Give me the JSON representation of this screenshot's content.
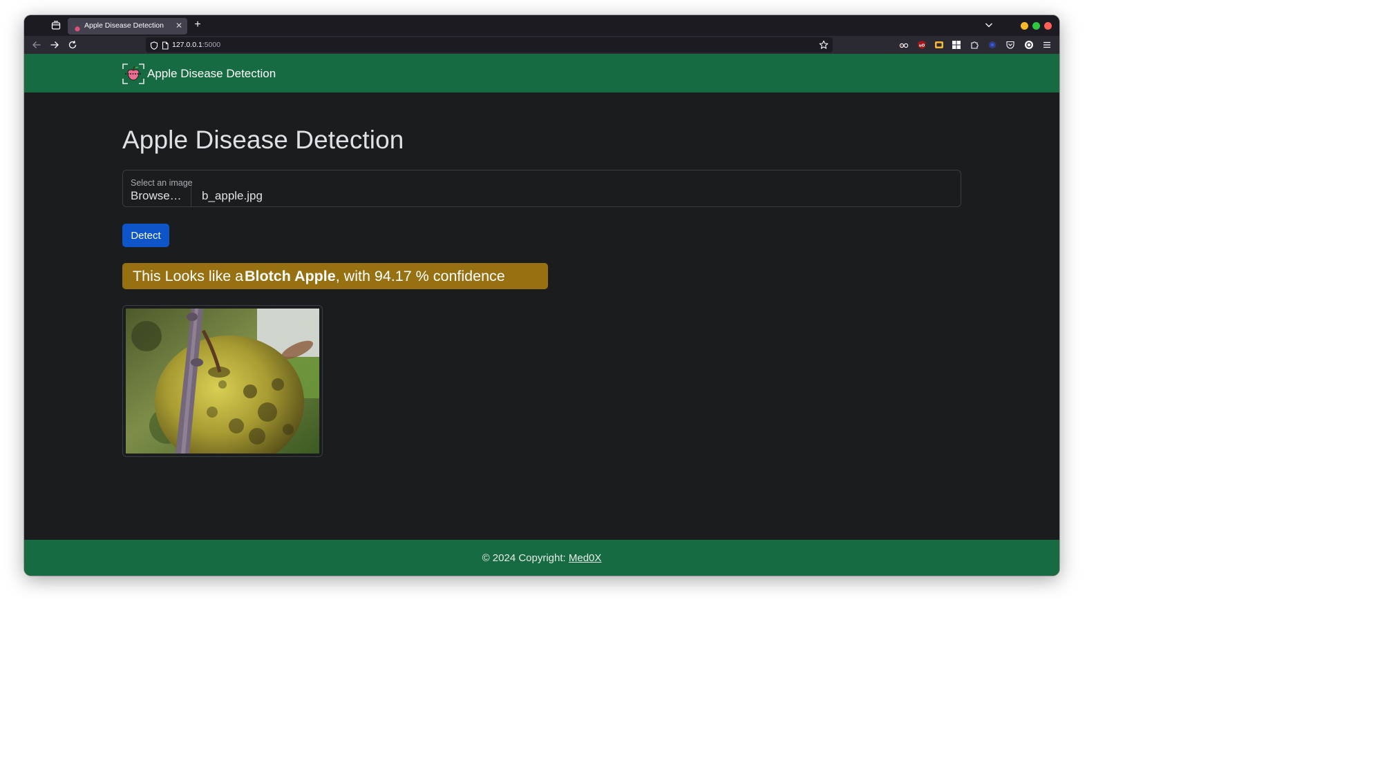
{
  "browser": {
    "tab": {
      "title": "Apple Disease Detection"
    },
    "url": {
      "host": "127.0.0.1",
      "port": ":5000"
    }
  },
  "site": {
    "brand": "Apple Disease Detection",
    "heading": "Apple Disease Detection",
    "upload": {
      "label": "Select an image",
      "browse_label": "Browse…",
      "file_name": "b_apple.jpg"
    },
    "detect_label": "Detect",
    "result": {
      "prefix": "This Looks like a ",
      "disease": "Blotch Apple",
      "suffix": ", with 94.17 % confidence"
    },
    "footer": {
      "text": "© 2024 Copyright: ",
      "link": "Med0X"
    }
  },
  "colors": {
    "navbar": "#166b42",
    "page_bg": "#1b1c1e",
    "detect_button": "#0d55c9",
    "result_badge": "#977111"
  },
  "icons": {
    "tab_list": "tab-list-icon",
    "favicon": "apple-favicon-icon",
    "close_tab": "close-icon",
    "new_tab": "plus-icon",
    "back": "back-arrow-icon",
    "forward": "forward-arrow-icon",
    "reload": "reload-icon",
    "shield": "shield-icon",
    "page": "page-icon",
    "bookmark": "star-icon",
    "menu": "hamburger-menu-icon"
  }
}
